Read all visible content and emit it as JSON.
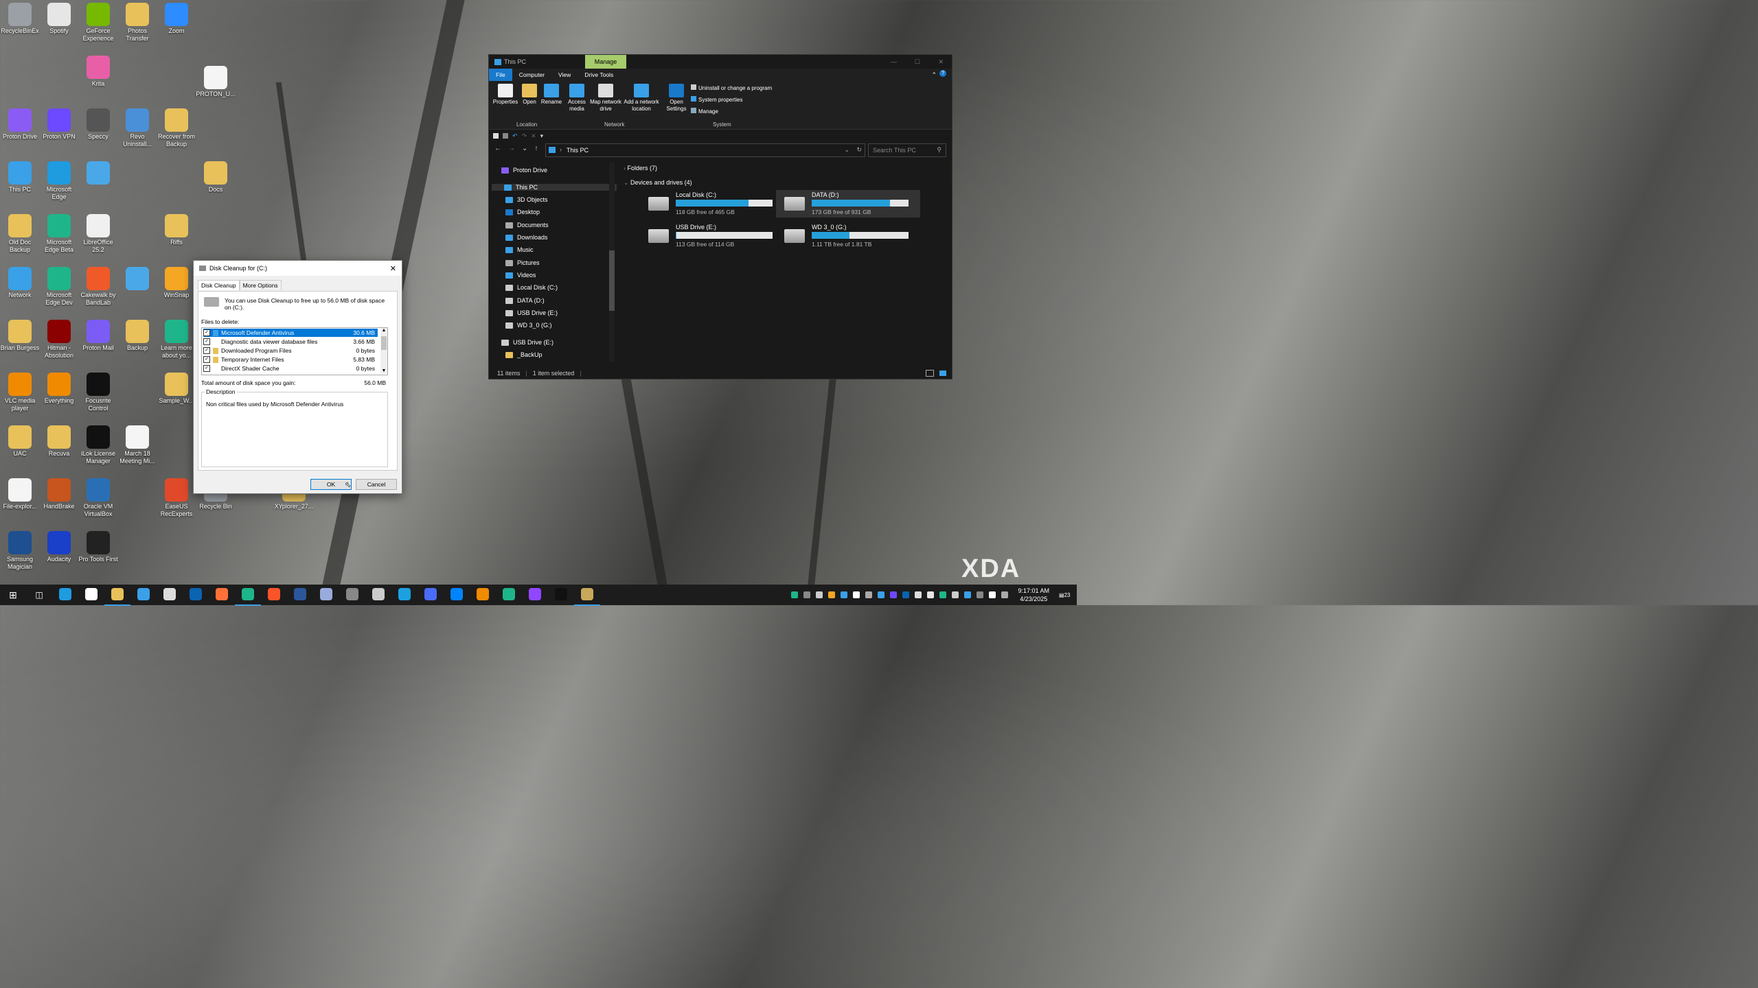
{
  "desktop": {
    "icons": [
      {
        "label": "RecycleBinEx",
        "color": "#9aa0a6"
      },
      {
        "label": "Spotify",
        "color": "#e6e6e6"
      },
      {
        "label": "GeForce Experience",
        "color": "#76b900"
      },
      {
        "label": "Photos Transfer",
        "color": "#e8c15a"
      },
      {
        "label": "Zoom",
        "color": "#2d8cff"
      },
      {
        "label": "Krita",
        "color": "#e85fa8"
      },
      {
        "label": "PROTON_U...",
        "color": "#f5f5f5"
      },
      {
        "label": "Proton Drive",
        "color": "#8a5cf5"
      },
      {
        "label": "Proton VPN",
        "color": "#6d4aff"
      },
      {
        "label": "Speccy",
        "color": "#555"
      },
      {
        "label": "Revo Uninstall...",
        "color": "#4a90d9"
      },
      {
        "label": "Recover from Backup",
        "color": "#e8c15a"
      },
      {
        "label": "This PC",
        "color": "#3aa0e8"
      },
      {
        "label": "Microsoft Edge",
        "color": "#1f9be0"
      },
      {
        "label": "",
        "color": "#4aa8e8"
      },
      {
        "label": "Docs",
        "color": "#e8c15a"
      },
      {
        "label": "Old Doc Backup",
        "color": "#e8c15a"
      },
      {
        "label": "Microsoft Edge Beta",
        "color": "#1fb58a"
      },
      {
        "label": "LibreOffice 25.2",
        "color": "#f0f0f0"
      },
      {
        "label": "Riffs",
        "color": "#e8c15a"
      },
      {
        "label": "Network",
        "color": "#3aa0e8"
      },
      {
        "label": "Microsoft Edge Dev",
        "color": "#1fb58a"
      },
      {
        "label": "Cakewalk by BandLab",
        "color": "#f05a28"
      },
      {
        "label": "",
        "color": "#4aa8e8"
      },
      {
        "label": "WinSnap",
        "color": "#f5a623"
      },
      {
        "label": "Brian Burgess",
        "color": "#e8c15a"
      },
      {
        "label": "Hitman - Absolution",
        "color": "#8b0000"
      },
      {
        "label": "Proton Mail",
        "color": "#7b5cf5"
      },
      {
        "label": "Backup",
        "color": "#e8c15a"
      },
      {
        "label": "Learn more about yo...",
        "color": "#1fb58a"
      },
      {
        "label": "VLC media player",
        "color": "#f08a00"
      },
      {
        "label": "Everything",
        "color": "#f08a00"
      },
      {
        "label": "Focusrite Control",
        "color": "#111"
      },
      {
        "label": "Sample_W...",
        "color": "#e8c15a"
      },
      {
        "label": "UAC",
        "color": "#e8c15a"
      },
      {
        "label": "Recuva",
        "color": "#e8c15a"
      },
      {
        "label": "iLok License Manager",
        "color": "#111"
      },
      {
        "label": "March 18 Meeting Mi...",
        "color": "#f5f5f5"
      },
      {
        "label": "File-explor...",
        "color": "#f5f5f5"
      },
      {
        "label": "HandBrake",
        "color": "#c8541e"
      },
      {
        "label": "Oracle VM VirtualBox",
        "color": "#2a6fb5"
      },
      {
        "label": "EaseUS RecExperts",
        "color": "#e04a2a"
      },
      {
        "label": "Recycle Bin",
        "color": "#9aa0a6"
      },
      {
        "label": "XYplorer_27...",
        "color": "#e8c15a"
      },
      {
        "label": "Samsung Magician",
        "color": "#1d4f91"
      },
      {
        "label": "Audacity",
        "color": "#1a3fc8"
      },
      {
        "label": "Pro Tools First",
        "color": "#222"
      }
    ]
  },
  "explorer": {
    "title": "This PC",
    "manage_tab": "Manage",
    "tabs": [
      "File",
      "Computer",
      "View",
      "Drive Tools"
    ],
    "ribbon": {
      "properties": "Properties",
      "open": "Open",
      "rename": "Rename",
      "access_media": "Access media",
      "map_drive": "Map network drive",
      "add_location": "Add a network location",
      "open_settings": "Open Settings",
      "uninstall": "Uninstall or change a program",
      "system_properties": "System properties",
      "manage": "Manage",
      "group_location": "Location",
      "group_network": "Network",
      "group_system": "System"
    },
    "address": "This PC",
    "search_placeholder": "Search This PC",
    "nav": [
      "Proton Drive",
      "This PC",
      "3D Objects",
      "Desktop",
      "Documents",
      "Downloads",
      "Music",
      "Pictures",
      "Videos",
      "Local Disk (C:)",
      "DATA (D:)",
      "USB Drive (E:)",
      "WD 3_0 (G:)",
      "USB Drive (E:)",
      "_BackUp"
    ],
    "folders_header": "Folders (7)",
    "devices_header": "Devices and drives (4)",
    "drives": [
      {
        "name": "Local Disk (C:)",
        "free": "118 GB free of 465 GB",
        "used_fraction": 0.75
      },
      {
        "name": "DATA (D:)",
        "free": "173 GB free of 931 GB",
        "used_fraction": 0.81
      },
      {
        "name": "USB Drive (E:)",
        "free": "113 GB free of 114 GB",
        "used_fraction": 0.01
      },
      {
        "name": "WD 3_0 (G:)",
        "free": "1.11 TB free of 1.81 TB",
        "used_fraction": 0.39
      }
    ],
    "status": {
      "items": "11 items",
      "selected": "1 item selected"
    }
  },
  "cleanup": {
    "title": "Disk Cleanup for  (C:)",
    "tab_cleanup": "Disk Cleanup",
    "tab_more": "More Options",
    "intro": "You can use Disk Cleanup to free up to 56.0 MB of disk space on (C:).",
    "files_label": "Files to delete:",
    "files": [
      {
        "name": "Microsoft Defender Antivirus",
        "size": "30.6 MB"
      },
      {
        "name": "Diagnostic data viewer database files",
        "size": "3.66 MB"
      },
      {
        "name": "Downloaded Program Files",
        "size": "0 bytes"
      },
      {
        "name": "Temporary Internet Files",
        "size": "5.83 MB"
      },
      {
        "name": "DirectX Shader Cache",
        "size": "0 bytes"
      }
    ],
    "total_label": "Total amount of disk space you gain:",
    "total_value": "56.0 MB",
    "desc_label": "Description",
    "desc_text": "Non critical files used by Microsoft Defender Antivirus",
    "ok": "OK",
    "cancel": "Cancel"
  },
  "taskbar": {
    "time": "9:17:01 AM",
    "date": "4/23/2025",
    "notif_count": "23"
  },
  "watermark": "XDA"
}
